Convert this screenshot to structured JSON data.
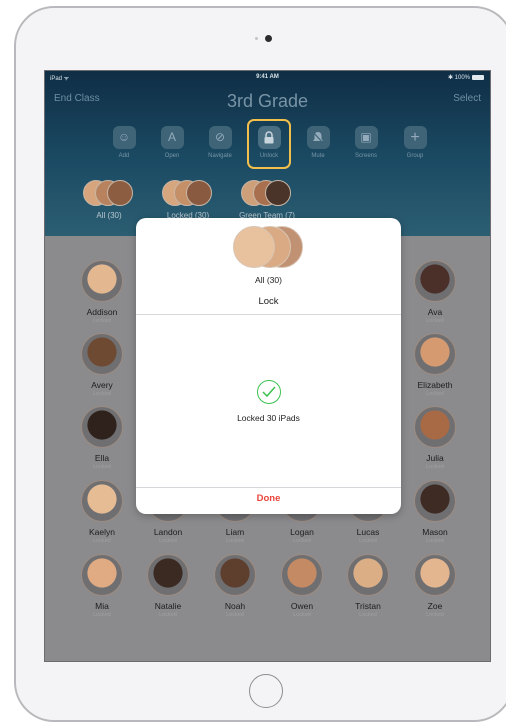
{
  "status_bar": {
    "carrier": "iPad ᯤ",
    "time": "9:41 AM",
    "battery": "✱ 100%"
  },
  "nav": {
    "left": "End Class",
    "title": "3rd Grade",
    "right": "Select"
  },
  "toolbar": [
    {
      "label": "Add",
      "icon": "person-icon",
      "glyph": "☺"
    },
    {
      "label": "Open",
      "icon": "app-store-icon",
      "glyph": "A"
    },
    {
      "label": "Navigate",
      "icon": "compass-icon",
      "glyph": "⊘"
    },
    {
      "label": "Unlock",
      "icon": "lock-icon",
      "glyph": "🔒"
    },
    {
      "label": "Mute",
      "icon": "bell-icon",
      "glyph": "🔔"
    },
    {
      "label": "Screens",
      "icon": "screens-icon",
      "glyph": "▣"
    },
    {
      "label": "Group",
      "icon": "plus-icon",
      "glyph": "+"
    }
  ],
  "groups": [
    {
      "label": "All (30)"
    },
    {
      "label": "Locked (30)"
    },
    {
      "label": "Green Team (7)"
    }
  ],
  "students": [
    {
      "name": "Addison",
      "status": "Locked",
      "color": "#e3b78f"
    },
    {
      "name": "Ava",
      "status": "Locked",
      "color": "#4a3028"
    },
    {
      "name": "Avery",
      "status": "Locked",
      "color": "#6f4a32"
    },
    {
      "name": "Elizabeth",
      "status": "Locked",
      "color": "#d59a6f"
    },
    {
      "name": "Ella",
      "status": "Locked",
      "color": "#2f221c"
    },
    {
      "name": "Julia",
      "status": "Locked",
      "color": "#a86a45"
    },
    {
      "name": "Kaelyn",
      "status": "Locked",
      "color": "#e6bc95"
    },
    {
      "name": "Landon",
      "status": "Locked",
      "color": "#c98d65"
    },
    {
      "name": "Liam",
      "status": "Locked",
      "color": "#b9805b"
    },
    {
      "name": "Logan",
      "status": "Locked",
      "color": "#d6a074"
    },
    {
      "name": "Lucas",
      "status": "Locked",
      "color": "#c78e67"
    },
    {
      "name": "Mason",
      "status": "Locked",
      "color": "#3e2c24"
    },
    {
      "name": "Mia",
      "status": "Locked",
      "color": "#e0aa82"
    },
    {
      "name": "Natalie",
      "status": "Locked",
      "color": "#3a2a22"
    },
    {
      "name": "Noah",
      "status": "Locked",
      "color": "#5e3e2c"
    },
    {
      "name": "Owen",
      "status": "Locked",
      "color": "#c48a63"
    },
    {
      "name": "Tristan",
      "status": "Locked",
      "color": "#dcae86"
    },
    {
      "name": "Zoe",
      "status": "Locked",
      "color": "#e4b690"
    }
  ],
  "dialog": {
    "group_label": "All (30)",
    "action": "Lock",
    "result": "Locked 30 iPads",
    "done_label": "Done"
  },
  "colors": {
    "accent_highlight": "#f2c04a",
    "success": "#3cc150",
    "destructive": "#e8453c"
  }
}
